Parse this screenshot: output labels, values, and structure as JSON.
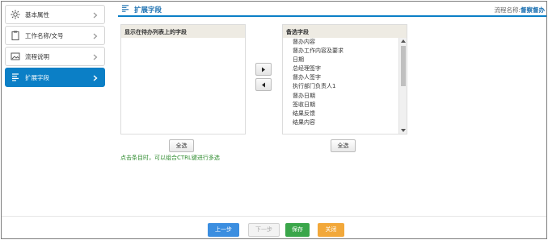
{
  "sidebar": {
    "items": [
      {
        "label": "基本属性",
        "icon": "gear-icon"
      },
      {
        "label": "工作名称/文号",
        "icon": "clipboard-icon"
      },
      {
        "label": "流程说明",
        "icon": "image-icon"
      },
      {
        "label": "扩展字段",
        "icon": "list-icon",
        "active": true
      }
    ]
  },
  "header": {
    "title": "扩展字段",
    "flow_label": "流程名称:",
    "flow_value": "督察督办"
  },
  "left_panel": {
    "title": "显示在待办列表上的字段",
    "items": []
  },
  "right_panel": {
    "title": "备选字段",
    "items": [
      "督办内容",
      "督办工作内容及要求",
      "日期",
      "总经理签字",
      "督办人签字",
      "执行部门负责人1",
      "督办日期",
      "签收日期",
      "结果反馈",
      "结果内容"
    ]
  },
  "buttons": {
    "move_right": "▸",
    "move_left": "◂",
    "select_all_left": "全选",
    "select_all_right": "全选",
    "prev": "上一步",
    "next": "下一步",
    "save": "保存",
    "close": "关闭"
  },
  "hint": "点击条目时，可以组合CTRL键进行多选",
  "colors": {
    "accent": "#0b7fc6",
    "prev": "#3b8ee0",
    "save": "#3aa64a",
    "close": "#f2a83a",
    "hint": "#2e8b2e"
  }
}
